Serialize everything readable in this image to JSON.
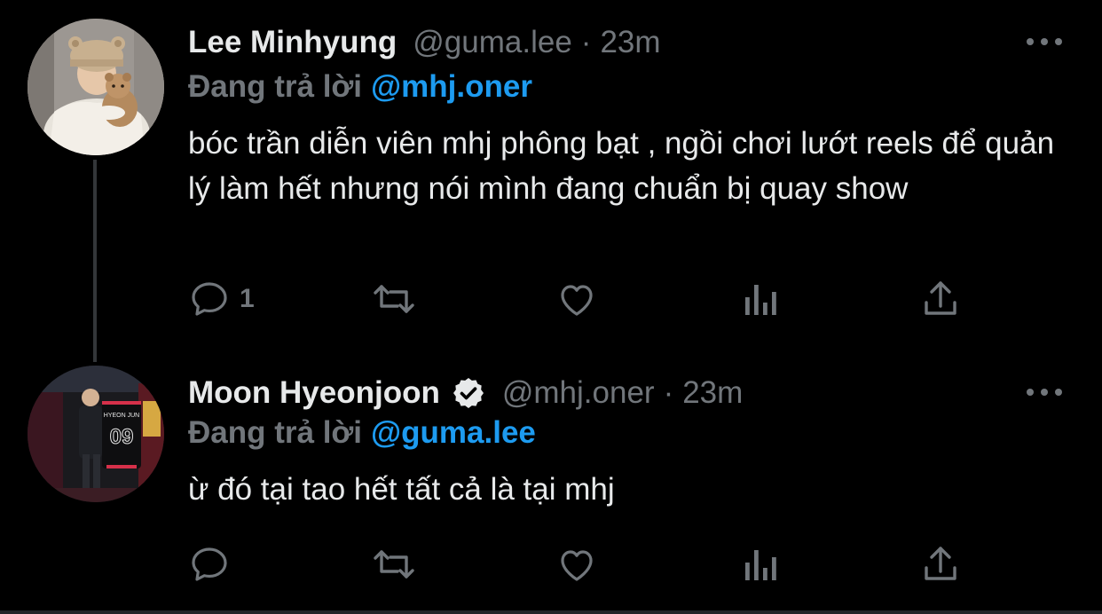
{
  "tweets": [
    {
      "author_name": "Lee Minhyung",
      "verified": false,
      "handle": "@guma.lee",
      "separator": "·",
      "time": "23m",
      "reply_prefix": "Đang trả lời",
      "reply_to": "@mhj.oner",
      "text": "bóc trần diễn viên mhj phông bạt , ngồi chơi lướt reels để quản lý làm hết nhưng nói mình đang chuẩn bị quay show",
      "actions": {
        "reply_icon": "comment-icon",
        "reply_count": "1",
        "retweet_icon": "retweet-icon",
        "like_icon": "heart-icon",
        "analytics_icon": "bar-chart-icon",
        "share_icon": "share-icon"
      }
    },
    {
      "author_name": "Moon Hyeonjoon",
      "verified": true,
      "handle": "@mhj.oner",
      "separator": "·",
      "time": "23m",
      "reply_prefix": "Đang trả lời",
      "reply_to": "@guma.lee",
      "text": "ừ đó tại tao hết tất cả là tại mhj",
      "jersey_text": "HYEON JUN",
      "jersey_number": "09",
      "actions": {
        "reply_icon": "comment-icon",
        "reply_count": "",
        "retweet_icon": "retweet-icon",
        "like_icon": "heart-icon",
        "analytics_icon": "bar-chart-icon",
        "share_icon": "share-icon"
      }
    }
  ],
  "colors": {
    "background": "#000000",
    "primary_text": "#e7e9ea",
    "secondary_text": "#71767b",
    "link": "#1d9bf0",
    "thread_line": "#333639"
  }
}
